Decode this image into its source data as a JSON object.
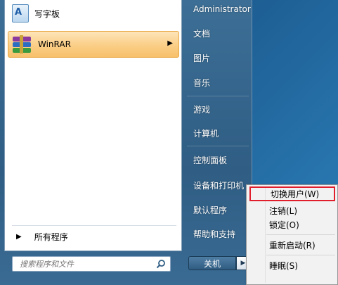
{
  "pinned_programs": [
    {
      "label": "写字板",
      "icon": "wordpad-icon"
    },
    {
      "label": "WinRAR",
      "icon": "winrar-icon",
      "submenu_arrow": "▶"
    }
  ],
  "all_programs": {
    "arrow": "▶",
    "label": "所有程序"
  },
  "search": {
    "placeholder": "搜索程序和文件"
  },
  "right_column": [
    "Administrator",
    "文档",
    "图片",
    "音乐",
    "游戏",
    "计算机",
    "控制面板",
    "设备和打印机",
    "默认程序",
    "帮助和支持"
  ],
  "shutdown": {
    "label": "关机",
    "arrow": "▶"
  },
  "power_submenu": [
    {
      "label": "切换用户(W)",
      "highlighted": true
    },
    {
      "label": "注销(L)"
    },
    {
      "label": "锁定(O)"
    },
    {
      "label": "重新启动(R)"
    },
    {
      "label": "睡眠(S)"
    }
  ],
  "colors": {
    "highlight_border": "#e01e2c",
    "selection_bg": "#fbd08a"
  }
}
